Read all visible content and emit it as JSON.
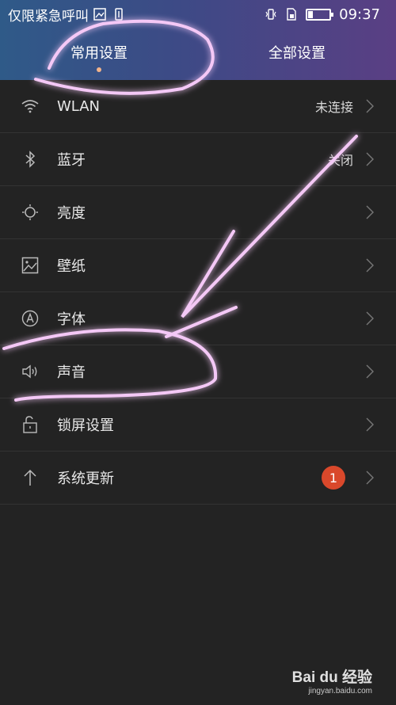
{
  "status_bar": {
    "carrier": "仅限紧急呼叫",
    "time": "09:37",
    "icons_left": [
      "image-icon",
      "sim-icon"
    ],
    "icons_right": [
      "vibrate-icon",
      "sim-card-icon",
      "battery-icon"
    ]
  },
  "tabs": [
    {
      "label": "常用设置",
      "active": true
    },
    {
      "label": "全部设置",
      "active": false
    }
  ],
  "settings": [
    {
      "label": "WLAN",
      "value": "未连接",
      "icon": "wifi-icon"
    },
    {
      "label": "蓝牙",
      "value": "关闭",
      "icon": "bluetooth-icon"
    },
    {
      "label": "亮度",
      "value": "",
      "icon": "brightness-icon"
    },
    {
      "label": "壁纸",
      "value": "",
      "icon": "wallpaper-icon"
    },
    {
      "label": "字体",
      "value": "",
      "icon": "font-icon"
    },
    {
      "label": "声音",
      "value": "",
      "icon": "sound-icon"
    },
    {
      "label": "锁屏设置",
      "value": "",
      "icon": "lock-icon"
    },
    {
      "label": "系统更新",
      "badge": "1",
      "icon": "update-icon"
    }
  ],
  "watermark": {
    "main": "Bai du 经验",
    "sub": "jingyan.baidu.com"
  },
  "colors": {
    "header_left": "#2f5a88",
    "header_right": "#5a3f84",
    "background": "#232323",
    "badge": "#d9482b",
    "annotation": "#e020e8"
  }
}
